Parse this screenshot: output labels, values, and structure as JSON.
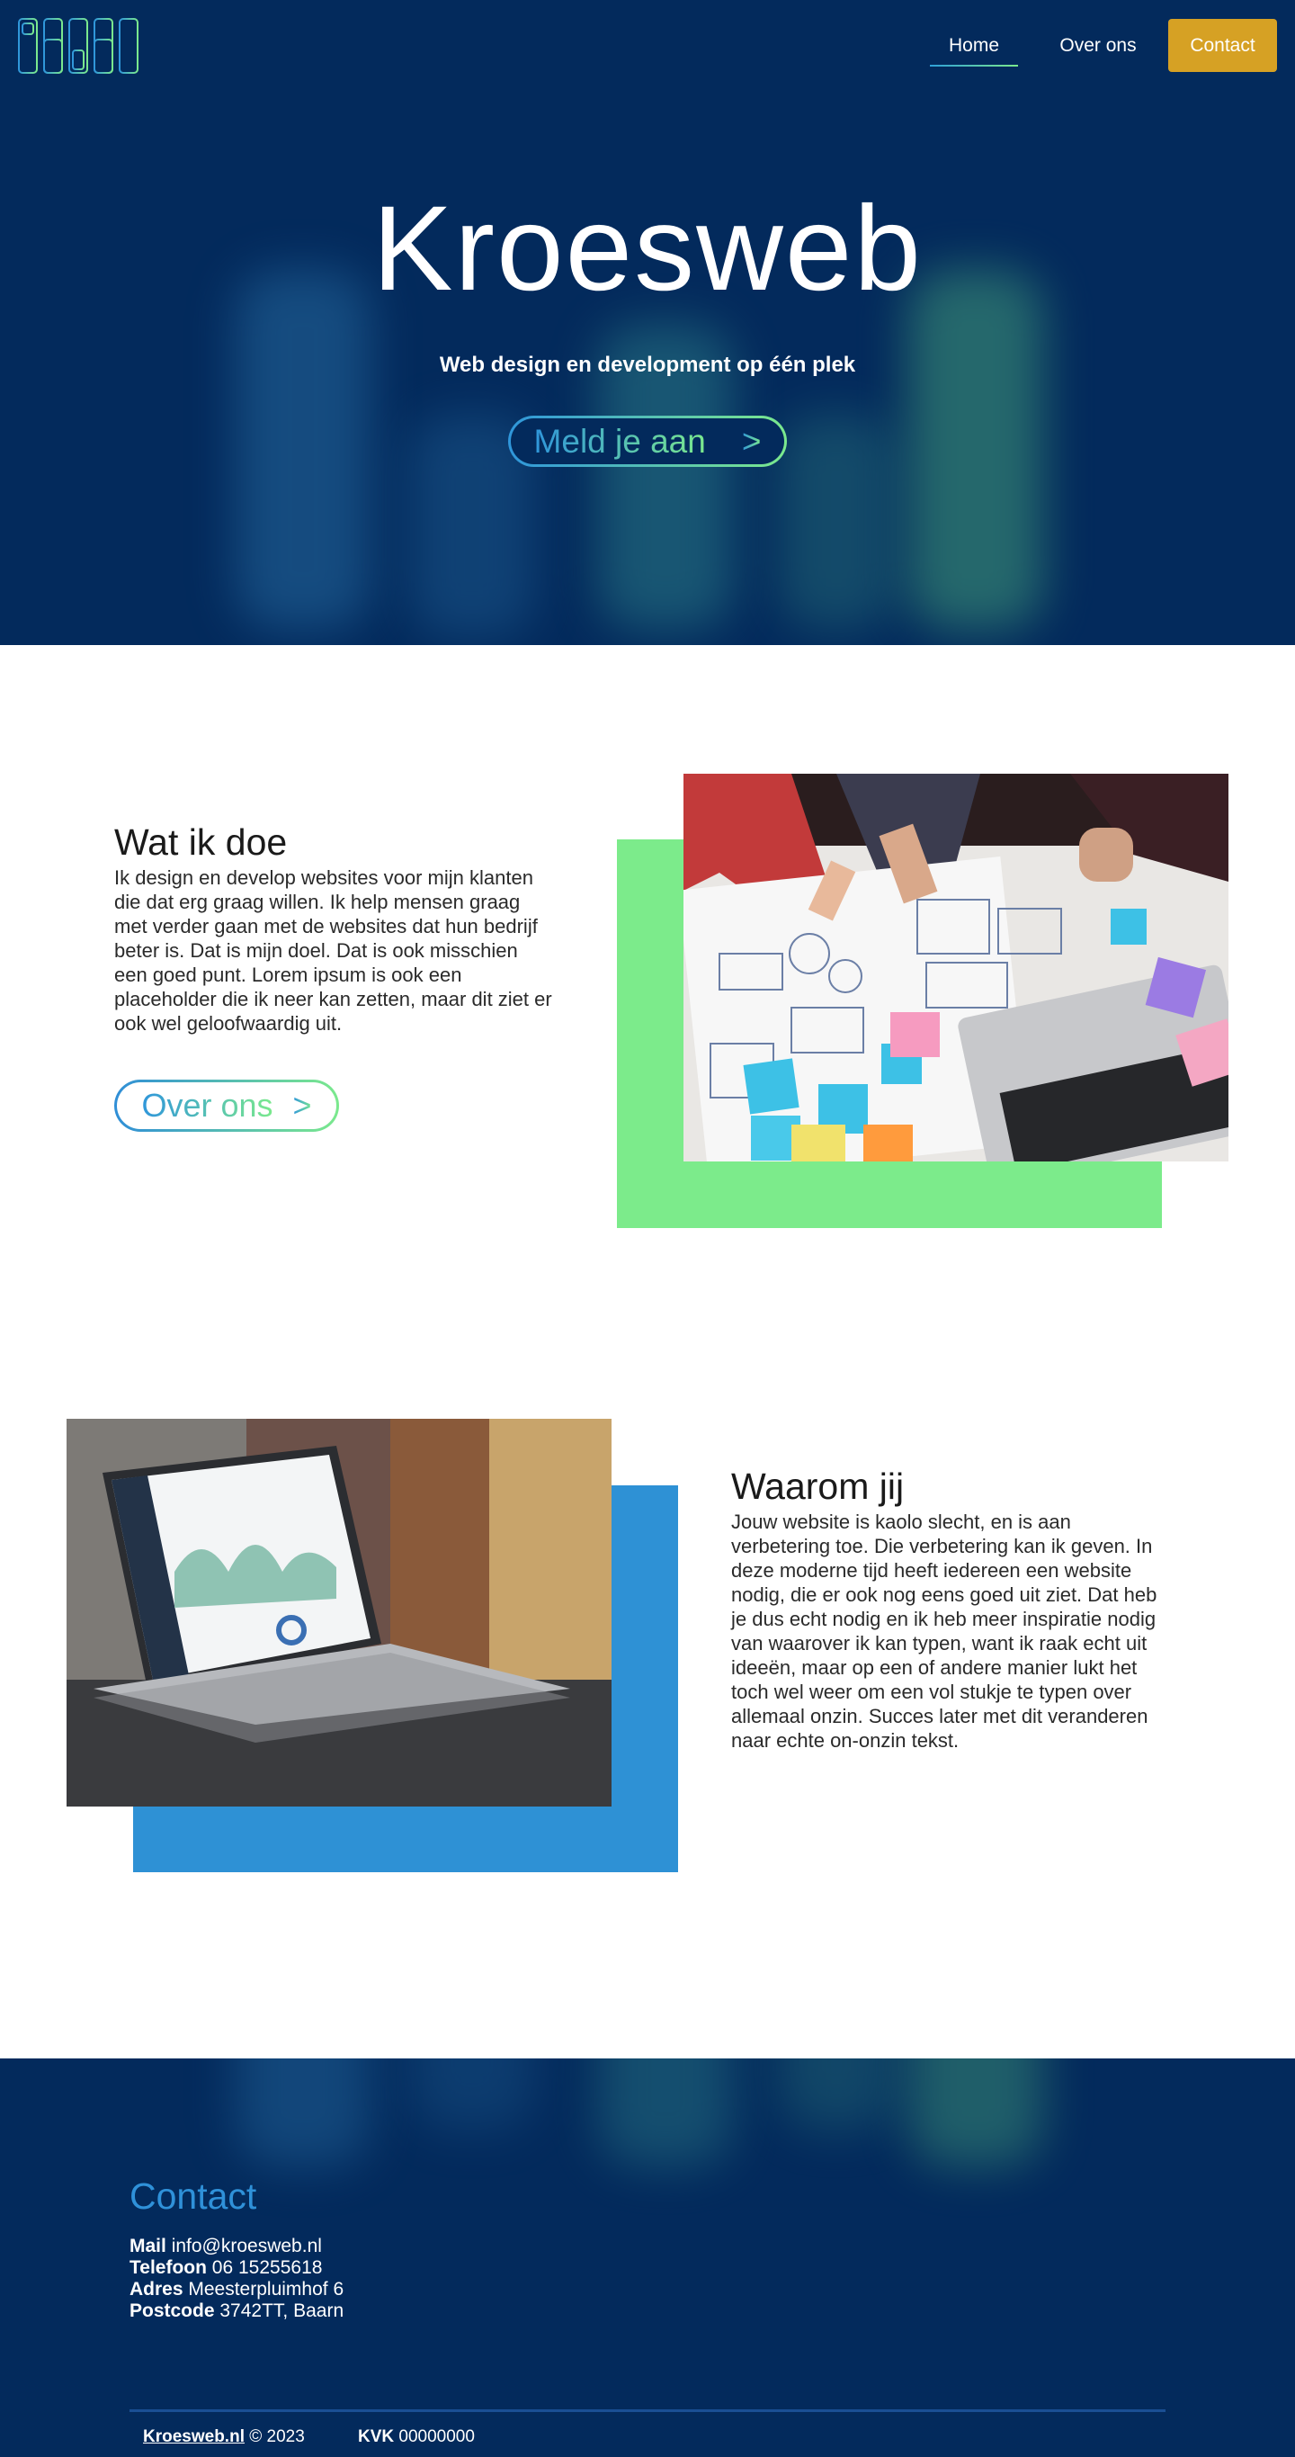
{
  "nav": {
    "home": "Home",
    "about": "Over ons",
    "contact": "Contact"
  },
  "hero": {
    "title": "Kroesweb",
    "subtitle": "Web design en development op één plek",
    "cta_label": "Meld je aan",
    "cta_arrow": ">"
  },
  "section_what": {
    "title": "Wat ik doe",
    "text": "Ik design en develop websites voor mijn klanten die dat erg graag willen. Ik help mensen graag met verder gaan met de websites dat hun bedrijf beter is. Dat is mijn doel. Dat is ook misschien een goed punt. Lorem ipsum is ook een placeholder die ik neer kan zetten, maar dit ziet er ook wel geloofwaardig uit.",
    "button_label": "Over ons",
    "button_arrow": ">"
  },
  "section_why": {
    "title": "Waarom jij",
    "text": "Jouw website is kaolo slecht, en is aan verbetering toe. Die verbetering kan ik geven. In deze moderne tijd heeft iedereen een website nodig, die er ook nog eens goed uit ziet. Dat heb je dus echt nodig en ik heb meer inspiratie nodig van waarover ik kan typen, want ik raak echt uit ideeën, maar op een of andere manier lukt het toch wel weer om een vol stukje te typen over allemaal onzin. Succes later met dit veranderen naar echte on-onzin tekst."
  },
  "footer": {
    "title": "Contact",
    "mail_label": "Mail",
    "mail_value": "info@kroesweb.nl",
    "phone_label": "Telefoon",
    "phone_value": "06 15255618",
    "address_label": "Adres",
    "address_value": "Meesterpluimhof 6",
    "postcode_label": "Postcode",
    "postcode_value": "3742TT, Baarn",
    "brand_link": "Kroesweb.nl",
    "copyright": "© 2023",
    "kvk_label": "KVK",
    "kvk_value": "00000000"
  },
  "colors": {
    "navy": "#032a5c",
    "gold": "#d6a124",
    "green": "#7ceb8b",
    "blue": "#2e91d5",
    "gradient_start": "#2f96db",
    "gradient_end": "#7be98d"
  },
  "icons": {
    "logo": "bar-chart-logo-icon"
  }
}
